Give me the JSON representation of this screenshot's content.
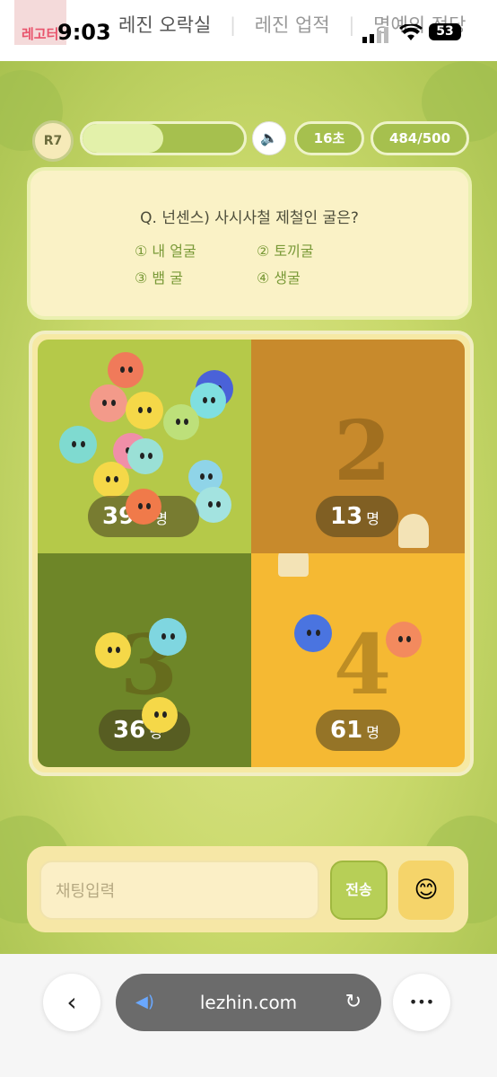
{
  "status_bar": {
    "time": "9:03",
    "battery": "53",
    "logo_text": "레고터",
    "tabs": [
      "레진 오락실",
      "레진 업적",
      "명예의 전당"
    ]
  },
  "game": {
    "round": "R7",
    "progress": 0.5,
    "sound_icon": "speaker-icon",
    "timer": "16초",
    "players": "484/500",
    "question": "Q. 넌센스) 사시사철 제철인 굴은?",
    "options": [
      "① 내 얼굴",
      "② 토끼굴",
      "③ 뱀 굴",
      "④ 생굴"
    ],
    "quadrants": [
      {
        "number": "1",
        "count": "390",
        "unit": "명",
        "color": "#b5c949"
      },
      {
        "number": "2",
        "count": "13",
        "unit": "명",
        "color": "#c88a2c"
      },
      {
        "number": "3",
        "count": "36",
        "unit": "명",
        "color": "#6e8628"
      },
      {
        "number": "4",
        "count": "61",
        "unit": "명",
        "color": "#f5b933"
      }
    ]
  },
  "chat": {
    "placeholder": "채팅입력",
    "send_label": "전송",
    "emoji": "😊"
  },
  "browser": {
    "url": "lezhin.com",
    "back_icon": "‹",
    "more_icon": "•••"
  }
}
